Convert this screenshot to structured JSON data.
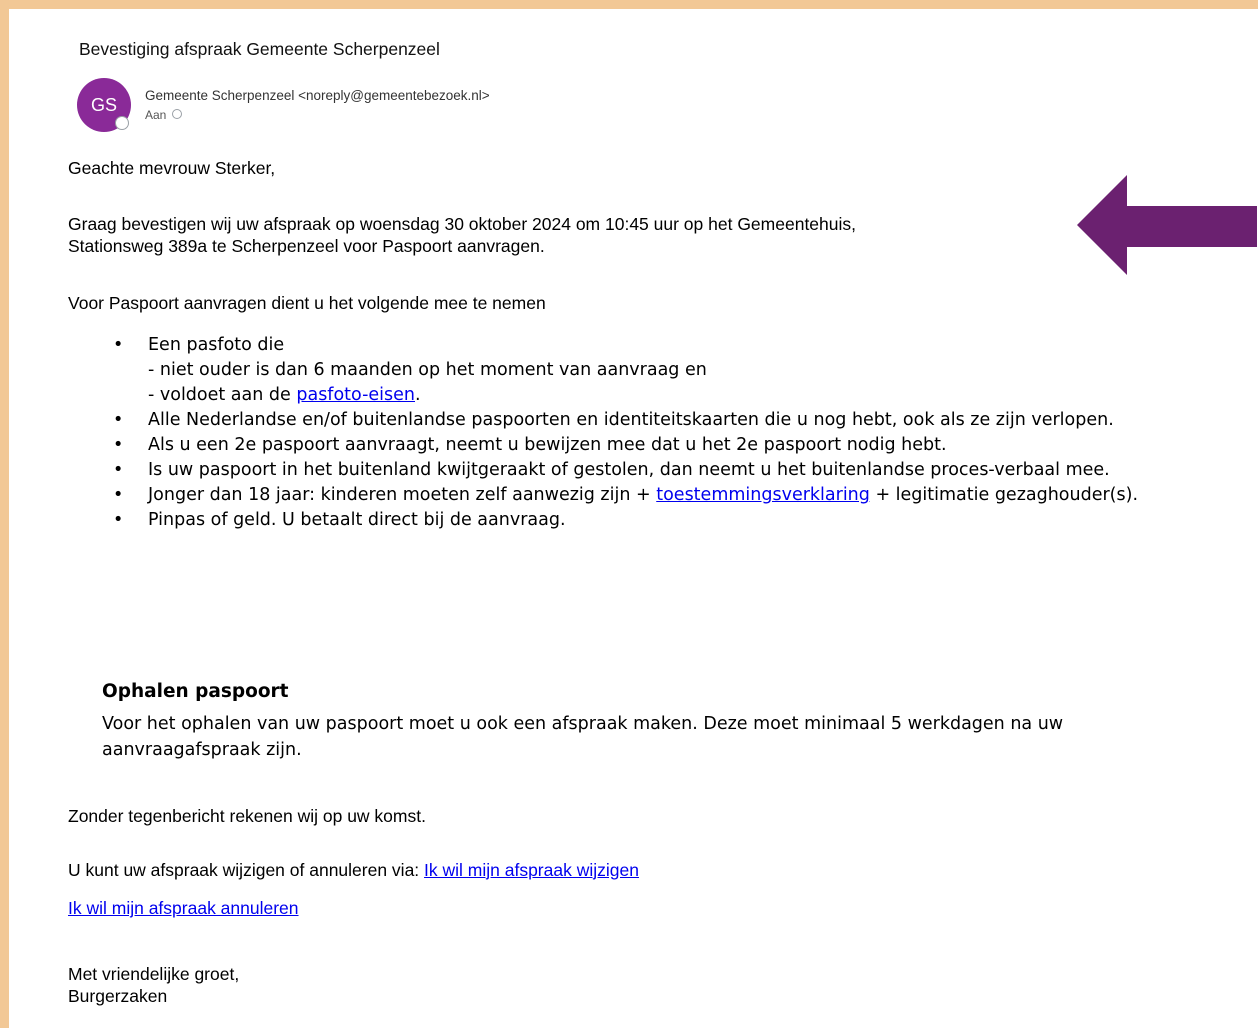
{
  "email": {
    "subject": "Bevestiging afspraak Gemeente Scherpenzeel",
    "avatar_initials": "GS",
    "sender": "Gemeente Scherpenzeel <noreply@gemeentebezoek.nl>",
    "to_label": "Aan",
    "accent_color": "#8a2a98"
  },
  "body": {
    "greeting": "Geachte mevrouw Sterker,",
    "confirm_line1": "Graag bevestigen wij uw afspraak op woensdag 30 oktober 2024 om 10:45 uur op het Gemeentehuis,",
    "confirm_line2": "Stationsweg 389a te Scherpenzeel voor Paspoort aanvragen.",
    "need_intro": "Voor Paspoort aanvragen dient u het volgende mee te nemen",
    "items": {
      "photo_l1": "Een pasfoto die",
      "photo_l2": "- niet ouder is dan 6 maanden op het moment van aanvraag en",
      "photo_l3_pre": "- voldoet aan de ",
      "photo_link": "pasfoto-eisen",
      "photo_l3_post": ".",
      "docs": "Alle Nederlandse en/of buitenlandse paspoorten en identiteitskaarten die u nog hebt, ook als ze zijn verlopen.",
      "second": "Als u een 2e paspoort aanvraagt, neemt u bewijzen mee dat u het 2e paspoort nodig hebt.",
      "lost": "Is uw paspoort in het buitenland kwijtgeraakt of gestolen, dan neemt u het buitenlandse proces-verbaal mee.",
      "minor_pre": "Jonger dan 18 jaar: kinderen moeten zelf aanwezig zijn + ",
      "minor_link": "toestemmingsverklaring",
      "minor_post": " + legitimatie gezaghouder(s).",
      "pay": "Pinpas of geld. U betaalt direct bij de aanvraag."
    },
    "pickup_title": "Ophalen paspoort",
    "pickup_text": "Voor het ophalen van uw paspoort moet u ook een afspraak maken. Deze moet minimaal 5 werkdagen na uw aanvraagafspraak zijn.",
    "no_reply": "Zonder tegenbericht rekenen wij op uw komst.",
    "change_pre": "U kunt uw afspraak wijzigen of annuleren via: ",
    "change_link": "Ik wil mijn afspraak wijzigen",
    "cancel_link": "Ik wil mijn afspraak annuleren",
    "closing": "Met vriendelijke groet,",
    "signature": "Burgerzaken"
  },
  "annotation": {
    "arrow_color": "#6b2170",
    "arrow_icon": "left-arrow-icon"
  }
}
